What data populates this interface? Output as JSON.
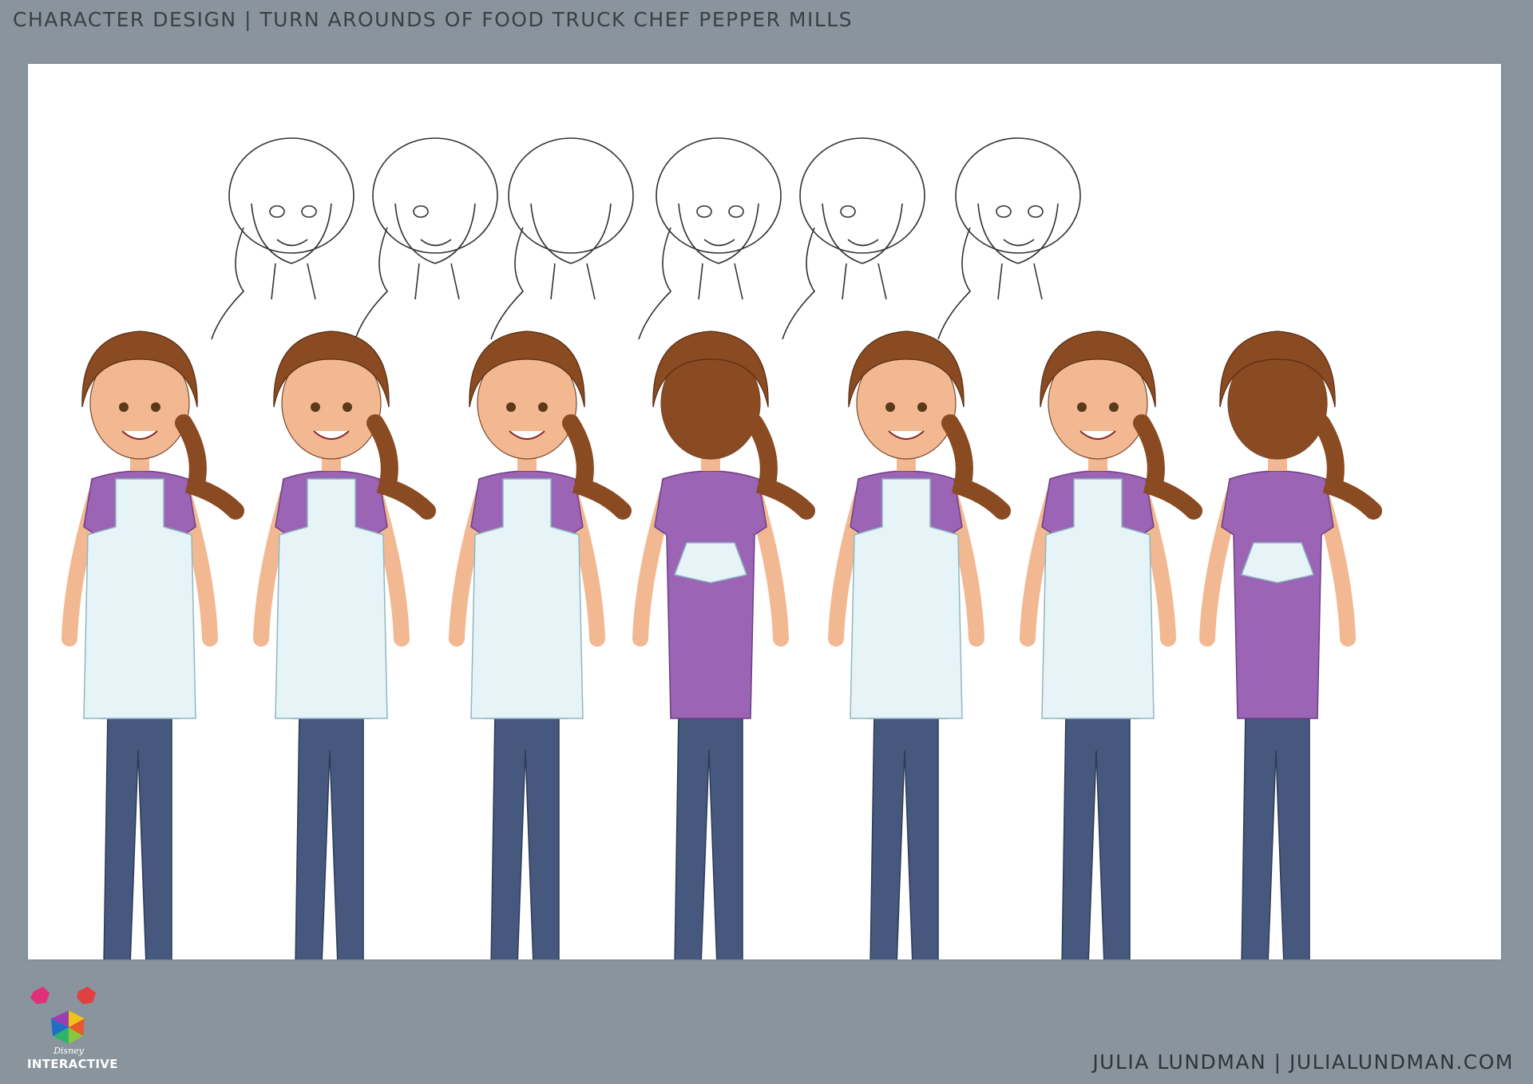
{
  "header": {
    "title": "Character Design | Turn Arounds of Food Truck Chef Pepper Mills"
  },
  "sheet": {
    "sketch_row": {
      "views": [
        "three-quarter-left",
        "profile-right",
        "back",
        "front",
        "profile-left",
        "three-quarter-right"
      ]
    },
    "color_row": {
      "views": [
        "profile-left",
        "three-quarter-left",
        "front",
        "back",
        "profile-right",
        "three-quarter-right",
        "back-three-quarter"
      ]
    },
    "palette": {
      "hair": "#8a4a22",
      "skin": "#f2b892",
      "shirt": "#9b64b4",
      "apron": "#e6f4f7",
      "pants": "#46587e",
      "shoes": "#9a5fb0",
      "line": "#333333"
    }
  },
  "logo": {
    "small_text": "Disney",
    "word": "INTERACTIVE"
  },
  "footer": {
    "credit": "Julia Lundman | julialundman.com"
  }
}
